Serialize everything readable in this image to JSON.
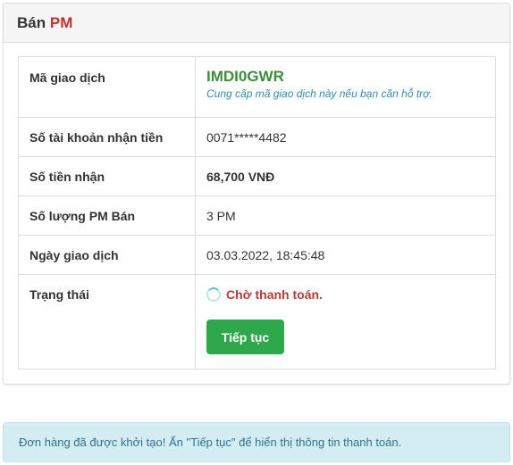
{
  "panel": {
    "title_prefix": "Bán",
    "title_accent": "PM"
  },
  "rows": {
    "transaction_code": {
      "label": "Mã giao dịch",
      "value": "IMDI0GWR",
      "hint": "Cung cấp mã giao dịch này nếu bạn cần hỗ trợ."
    },
    "account": {
      "label": "Số tài khoản nhận tiền",
      "value": "0071*****4482"
    },
    "amount": {
      "label": "Số tiền nhận",
      "value": "68,700 VNĐ"
    },
    "quantity": {
      "label": "Số lượng PM Bán",
      "value": "3 PM"
    },
    "date": {
      "label": "Ngày giao dịch",
      "value": "03.03.2022, 18:45:48"
    },
    "status": {
      "label": "Trạng thái",
      "value": "Chờ thanh toán.",
      "icon": "spinner-icon",
      "button_label": "Tiếp tục"
    }
  },
  "alert": {
    "message": "Đơn hàng đã được khởi tạo! Ấn \"Tiếp tục\" để hiển thị thông tin thanh toán."
  },
  "colors": {
    "code_green": "#3c8d3c",
    "hint_teal": "#2e8fa6",
    "status_red": "#b93a3a",
    "button_green": "#2ea84a",
    "alert_bg": "#d4edf3",
    "accent_red": "#c9302c"
  }
}
